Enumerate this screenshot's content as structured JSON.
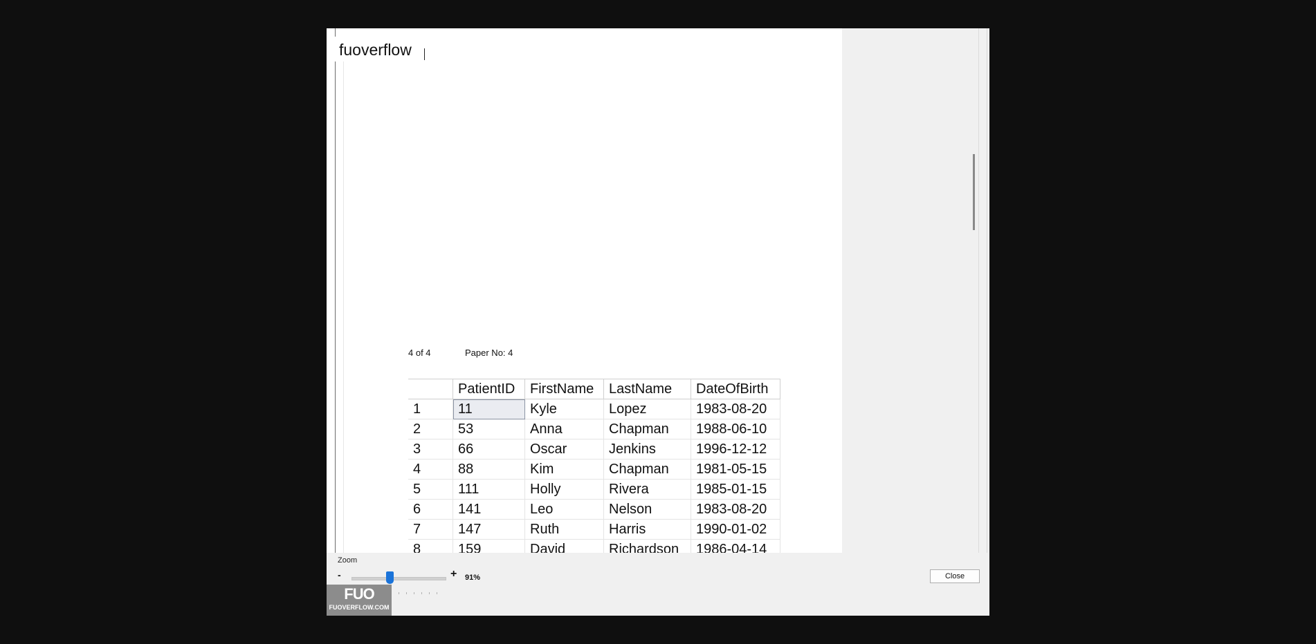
{
  "document": {
    "title": "fuoverflow",
    "page_counter": "4 of 4",
    "paper_no": "Paper No: 4"
  },
  "table": {
    "headers": [
      "",
      "PatientID",
      "FirstName",
      "LastName",
      "DateOfBirth"
    ],
    "rows": [
      [
        "1",
        "11",
        "Kyle",
        "Lopez",
        "1983-08-20"
      ],
      [
        "2",
        "53",
        "Anna",
        "Chapman",
        "1988-06-10"
      ],
      [
        "3",
        "66",
        "Oscar",
        "Jenkins",
        "1996-12-12"
      ],
      [
        "4",
        "88",
        "Kim",
        "Chapman",
        "1981-05-15"
      ],
      [
        "5",
        "111",
        "Holly",
        "Rivera",
        "1985-01-15"
      ],
      [
        "6",
        "141",
        "Leo",
        "Nelson",
        "1983-08-20"
      ],
      [
        "7",
        "147",
        "Ruth",
        "Harris",
        "1990-01-02"
      ],
      [
        "8",
        "159",
        "David",
        "Richardson",
        "1986-04-14"
      ]
    ],
    "selected_cell": {
      "row": 0,
      "col": 1
    }
  },
  "zoom": {
    "label": "Zoom",
    "minus": "-",
    "plus": "+",
    "value_text": "91%",
    "slider_fraction": 0.41
  },
  "buttons": {
    "close": "Close"
  },
  "logo": {
    "mark": "FUO",
    "text": "FUOVERFLOW.COM"
  },
  "colors": {
    "backdrop": "#0f0f0f",
    "window": "#f0f0f0",
    "slider_thumb": "#1a73d9"
  }
}
